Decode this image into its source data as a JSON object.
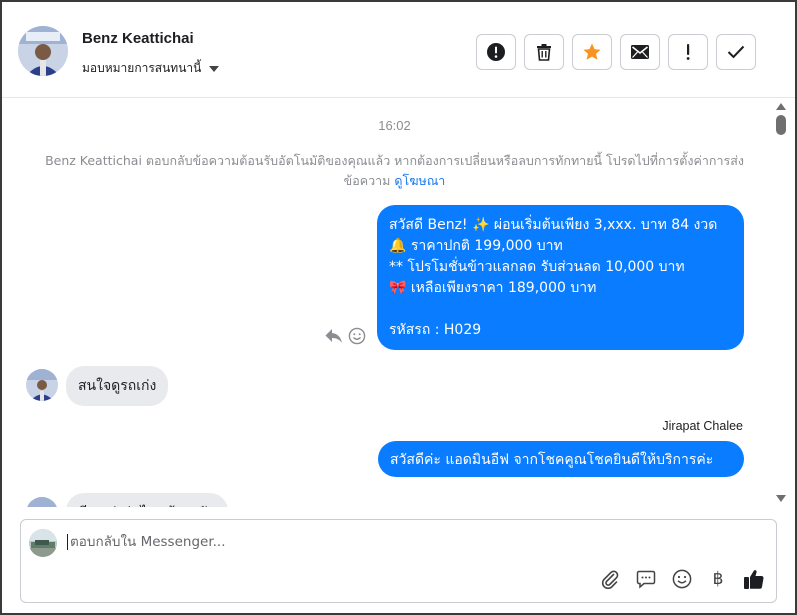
{
  "header": {
    "contact_name": "Benz Keattichai",
    "assign_label": "มอบหมายการสนทนานี้",
    "actions": [
      {
        "icon": "alert-circle-icon",
        "name": "mark-spam-button"
      },
      {
        "icon": "trash-icon",
        "name": "delete-button"
      },
      {
        "icon": "star-icon",
        "name": "star-button",
        "color": "#f7931e"
      },
      {
        "icon": "envelope-icon",
        "name": "mark-unread-button"
      },
      {
        "icon": "exclamation-icon",
        "name": "follow-up-button"
      },
      {
        "icon": "check-icon",
        "name": "mark-done-button"
      }
    ]
  },
  "thread": {
    "timestamp": "16:02",
    "system_message": "Benz Keattichai ตอบกลับข้อความต้อนรับอัตโนมัติของคุณแล้ว หากต้องการเปลี่ยนหรือลบการทักทายนี้ โปรดไปที่การตั้งค่าการส่งข้อความ",
    "system_link": "ดูโฆษณา",
    "outgoing_promo": {
      "lines": [
        "สวัสดี Benz! ✨  ผ่อนเริ่มต้นเพียง 3,xxx. บาท 84 งวด",
        "🔔 ราคาปกติ  199,000 บาท",
        "** โปรโมชั่นข้าวแลกลด รับส่วนลด 10,000 บาท",
        "🎀  เหลือเพียงราคา 189,000 บาท",
        "",
        " รหัสรถ : H029"
      ]
    },
    "incoming_1": "สนใจดูรถเก่ง",
    "reply_sender": "Jirapat Chalee",
    "outgoing_reply": "สวัสดีค่ะ แอดมินอีฟ จากโชคคูณโชคยินดีให้บริการค่ะ",
    "incoming_2_partial": "มีรถเก่งรุ่นไหนบ้างครับ"
  },
  "composer": {
    "placeholder": "ตอบกลับใน Messenger...",
    "tools": [
      "paperclip-icon",
      "chat-bubble-icon",
      "emoji-icon",
      "baht-icon",
      "thumbs-up-icon"
    ],
    "baht_symbol": "฿"
  },
  "colors": {
    "bubble_out": "#0a7cff",
    "bubble_in": "#e9eaed",
    "link": "#1877f2",
    "star": "#f7931e"
  }
}
